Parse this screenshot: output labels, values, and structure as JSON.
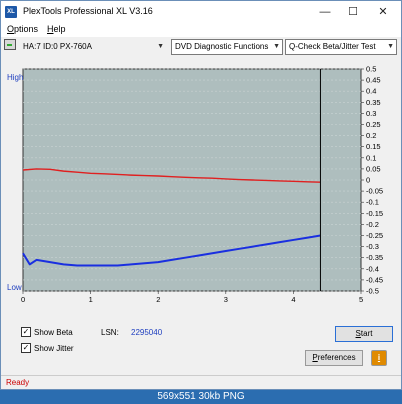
{
  "window": {
    "title": "PlexTools Professional XL V3.16",
    "app_icon_text": "XL",
    "controls": {
      "minimize": "—",
      "maximize": "☐",
      "close": "✕"
    }
  },
  "menu": [
    "Options",
    "Help"
  ],
  "toolbar": {
    "drive": "HA:7 ID:0  PX-760A",
    "function": "DVD Diagnostic Functions",
    "test": "Q-Check Beta/Jitter Test"
  },
  "chart_data": {
    "type": "line",
    "left_axis": {
      "top_label": "High",
      "bottom_label": "Low"
    },
    "x_ticks": [
      "0",
      "1",
      "2",
      "3",
      "4",
      "5"
    ],
    "y_ticks": [
      "0.5",
      "0.45",
      "0.4",
      "0.35",
      "0.3",
      "0.25",
      "0.2",
      "0.15",
      "0.1",
      "0.05",
      "0",
      "-0.05",
      "-0.1",
      "-0.15",
      "-0.2",
      "-0.25",
      "-0.3",
      "-0.35",
      "-0.4",
      "-0.45",
      "-0.5"
    ],
    "xlim": [
      0,
      5
    ],
    "ylim": [
      -0.5,
      0.5
    ],
    "cursor_x": 4.4,
    "background_color": "#aebebe",
    "series": [
      {
        "color": "#e02020",
        "x": [
          0,
          0.2,
          0.4,
          0.6,
          0.8,
          1.0,
          1.2,
          1.4,
          1.6,
          1.8,
          2.0,
          2.2,
          2.4,
          2.6,
          2.8,
          3.0,
          3.2,
          3.4,
          3.6,
          3.8,
          4.0,
          4.2,
          4.4
        ],
        "y": [
          0.045,
          0.05,
          0.048,
          0.04,
          0.035,
          0.03,
          0.028,
          0.025,
          0.022,
          0.02,
          0.018,
          0.015,
          0.012,
          0.01,
          0.008,
          0.005,
          0.002,
          0.0,
          -0.002,
          -0.004,
          -0.006,
          -0.008,
          -0.01
        ]
      },
      {
        "color": "#1a2fe0",
        "x": [
          0,
          0.1,
          0.2,
          0.4,
          0.6,
          0.8,
          1.0,
          1.2,
          1.4,
          1.6,
          1.8,
          2.0,
          2.2,
          2.4,
          2.6,
          2.8,
          3.0,
          3.2,
          3.4,
          3.6,
          3.8,
          4.0,
          4.2,
          4.4
        ],
        "y": [
          -0.33,
          -0.38,
          -0.36,
          -0.37,
          -0.38,
          -0.385,
          -0.385,
          -0.385,
          -0.385,
          -0.38,
          -0.375,
          -0.37,
          -0.36,
          -0.35,
          -0.34,
          -0.33,
          -0.32,
          -0.31,
          -0.3,
          -0.29,
          -0.28,
          -0.27,
          -0.26,
          -0.25
        ]
      }
    ]
  },
  "bottom": {
    "show_beta": "Show Beta",
    "show_jitter": "Show Jitter",
    "lsn_label": "LSN:",
    "lsn_value": "2295040",
    "start": "Start",
    "preferences": "Preferences",
    "info_icon": "i"
  },
  "status": "Ready",
  "caption": "569x551 30kb PNG"
}
